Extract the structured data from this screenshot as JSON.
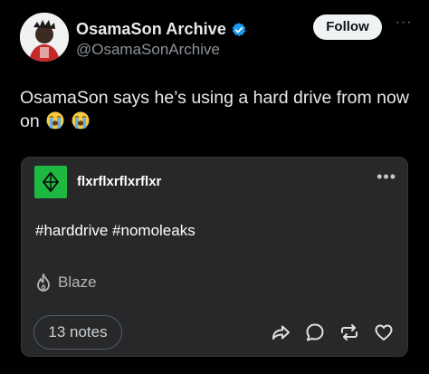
{
  "header": {
    "display_name": "OsamaSon Archive",
    "handle": "@OsamaSonArchive",
    "follow_label": "Follow",
    "verified_color": "#1d9bf0"
  },
  "tweet": {
    "text": "OsamaSon says he’s using a hard drive from now on",
    "emojis": [
      "loudly-crying-face-emoji",
      "loudly-crying-face-emoji"
    ]
  },
  "embedded_post": {
    "blog_name": "flxrflxrflxrflxr",
    "blog_icon_color": "#1eb940",
    "text": "#harddrive #nomoleaks",
    "blaze_label": "Blaze",
    "notes_label": "13 notes",
    "actions": [
      "share-icon",
      "reply-icon",
      "reblog-icon",
      "like-icon"
    ]
  }
}
